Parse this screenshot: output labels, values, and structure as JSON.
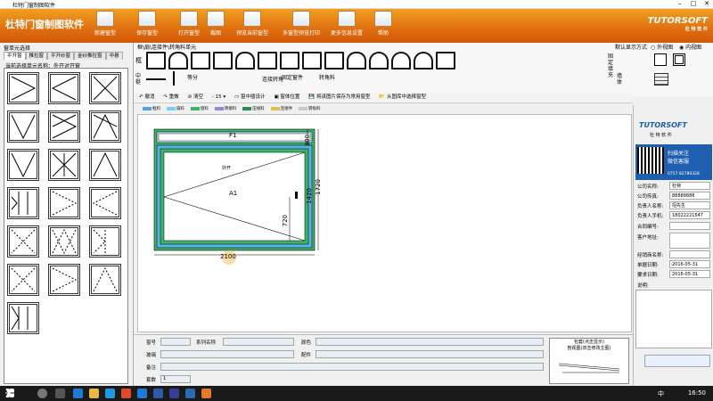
{
  "window": {
    "title": "杜特门窗制图软件"
  },
  "ribbon": {
    "app_name": "杜特门窗制图软件",
    "buttons": [
      "新建窗型",
      "保存窗型",
      "打开窗型",
      "截图",
      "预览当前窗型",
      "多窗型预览打印",
      "更多信息设置",
      "帮助"
    ]
  },
  "logo": {
    "text": "TUTORSOFT",
    "sub": "杜 特 软 件"
  },
  "left": {
    "header": "窗单元选择",
    "tabs": [
      "平开窗",
      "推拉窗",
      "平开纱窗",
      "金纱推拉窗",
      "中悬"
    ],
    "current": "当前选择单元名称：外开对开窗"
  },
  "top": {
    "breadcrumb": "框\\扇\\连接件\\转角料单元",
    "display_mode_label": "默认显示方式",
    "radio_outer": "外视图",
    "radio_inner": "内视图",
    "frame_label": "框",
    "mullion_label": "中梃",
    "fill_label": "固定填充",
    "wall_label": "墙体",
    "mullion_items": [
      "等分",
      "连接转角",
      "固定窗件",
      "转角料"
    ]
  },
  "toolbar2": [
    "撤消",
    "重做",
    "清空",
    "15",
    "窗中插设计",
    "窗体位置",
    "将该图片保存为常用窗型",
    "从图库中选择窗型"
  ],
  "legend": [
    {
      "label": "框料",
      "color": "#5aa0d8"
    },
    {
      "label": "扇料",
      "color": "#88c8f0"
    },
    {
      "label": "窗料",
      "color": "#3cb46c"
    },
    {
      "label": "转接料",
      "color": "#9a8acb"
    },
    {
      "label": "压线料",
      "color": "#2e8b57"
    },
    {
      "label": "连接件",
      "color": "#e0c050"
    },
    {
      "label": "转角料",
      "color": "#c8c8c8"
    }
  ],
  "drawing": {
    "fixed_label": "F1",
    "sash_label": "A1",
    "opening_label": "外开",
    "dim_top": "300",
    "dim_total_h": "1720",
    "dim_inner_h": "1420",
    "dim_handle": "720",
    "dim_width": "2100"
  },
  "right": {
    "brand": "TUTORSOFT",
    "brand_sub": "杜 特 软 件",
    "qr_text": "扫描关注\n微信客服",
    "phone": "0757 82780328",
    "fields": [
      {
        "k": "公司名称:",
        "v": "杜特"
      },
      {
        "k": "公司传真:",
        "v": "88888888"
      },
      {
        "k": "负责人名称:",
        "v": "招先生"
      },
      {
        "k": "负责人手机:",
        "v": "18022221547"
      },
      {
        "k": "合同编号:",
        "v": ""
      },
      {
        "k": "客户地址:",
        "v": ""
      },
      {
        "k": "经销商名称:",
        "v": ""
      },
      {
        "k": "单据日期:",
        "v": "2016-05-31"
      },
      {
        "k": "要求日期:",
        "v": "2016-05-31"
      },
      {
        "k": "说明:",
        "v": ""
      }
    ]
  },
  "bottom": {
    "window_no_label": "窗号",
    "series_label": "系列名称",
    "color_label": "颜色",
    "glass_label": "玻璃",
    "hardware_label": "配件",
    "note_label": "备注",
    "qty_label": "套数",
    "qty_value": "1",
    "cut_title": "包套(点击显示)",
    "cut_sub": "剖视图(双击修改主图)"
  },
  "taskbar": {
    "time": "16:50",
    "lang": "中"
  }
}
